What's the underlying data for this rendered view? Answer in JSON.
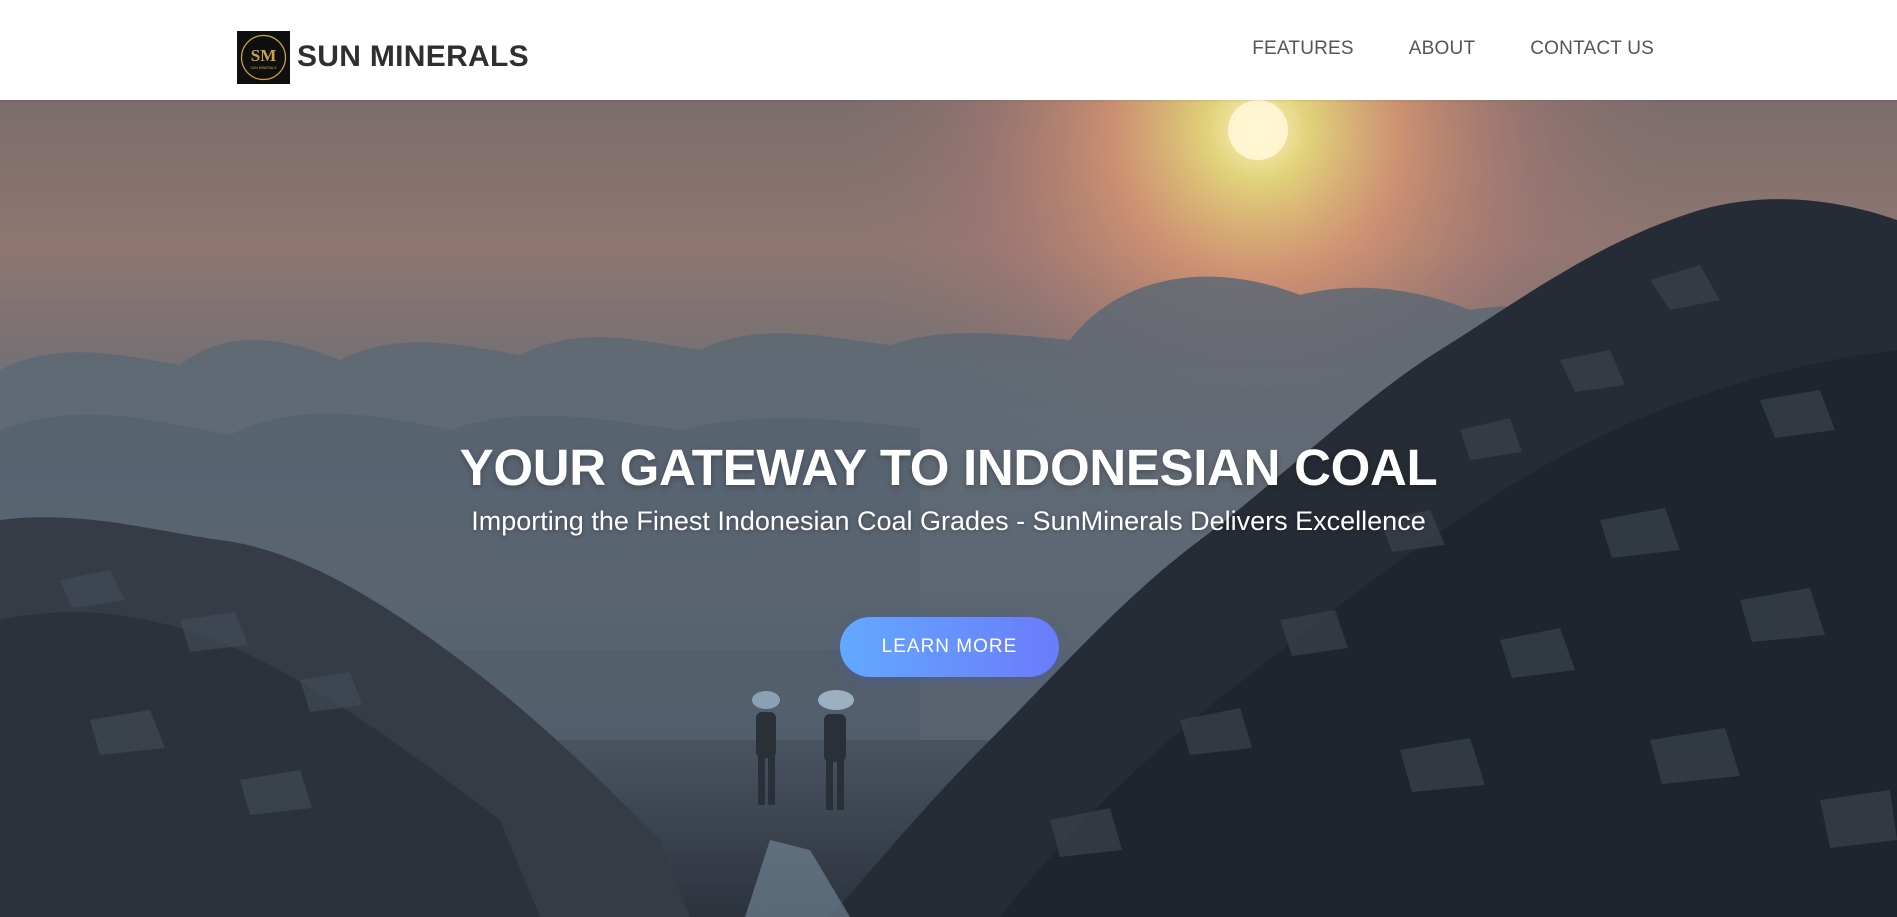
{
  "navbar": {
    "logo": {
      "monogram": "SM",
      "tagline": "SUN MINERALS",
      "background": "#0f0f0f",
      "gold": "#c9a24a"
    },
    "brand_name": "SUN MINERALS",
    "links": [
      {
        "label": "FEATURES"
      },
      {
        "label": "ABOUT"
      },
      {
        "label": "CONTACT US"
      }
    ]
  },
  "hero": {
    "title": "YOUR GATEWAY TO INDONESIAN COAL",
    "subtitle": "Importing the Finest Indonesian Coal Grades - SunMinerals Delivers Excellence",
    "cta_label": "LEARN MORE",
    "cta_gradient": [
      "#62a9ff",
      "#6b7bfa"
    ]
  },
  "colors": {
    "brand_text": "#2f2f2f",
    "nav_text": "#555555",
    "hero_text": "#ffffff"
  }
}
